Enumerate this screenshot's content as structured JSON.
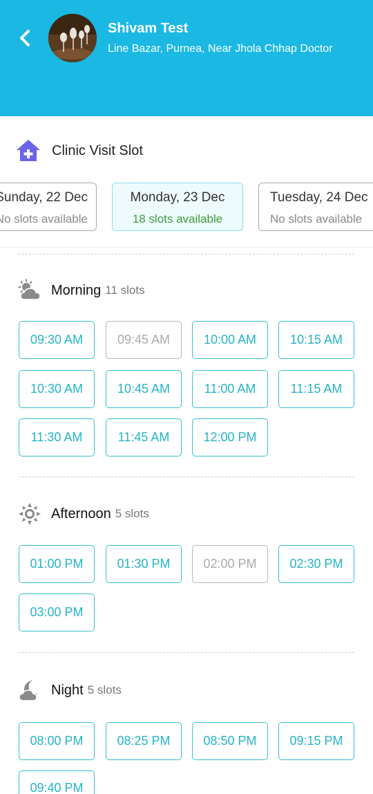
{
  "header": {
    "doctor_name": "Shivam Test",
    "address": "Line Bazar, Purnea, Near Jhola Chhap Doctor",
    "back_icon": "chevron-left-icon",
    "bg_color": "#1ab8e3"
  },
  "section": {
    "title": "Clinic Visit Slot",
    "icon": "clinic-plus-icon",
    "icon_color": "#6b63e8"
  },
  "dates": [
    {
      "day": "Sunday, 22 Dec",
      "availability": "No slots available",
      "selected": false
    },
    {
      "day": "Monday, 23 Dec",
      "availability": "18 slots available",
      "selected": true
    },
    {
      "day": "Tuesday, 24 Dec",
      "availability": "No slots available",
      "selected": false
    }
  ],
  "periods": [
    {
      "name": "Morning",
      "count": "11 slots",
      "icon": "sun-cloud-icon",
      "slots": [
        {
          "time": "09:30 AM",
          "enabled": true
        },
        {
          "time": "09:45 AM",
          "enabled": false
        },
        {
          "time": "10:00 AM",
          "enabled": true
        },
        {
          "time": "10:15 AM",
          "enabled": true
        },
        {
          "time": "10:30 AM",
          "enabled": true
        },
        {
          "time": "10:45 AM",
          "enabled": true
        },
        {
          "time": "11:00 AM",
          "enabled": true
        },
        {
          "time": "11:15 AM",
          "enabled": true
        },
        {
          "time": "11:30 AM",
          "enabled": true
        },
        {
          "time": "11:45 AM",
          "enabled": true
        },
        {
          "time": "12:00 PM",
          "enabled": true
        }
      ]
    },
    {
      "name": "Afternoon",
      "count": "5 slots",
      "icon": "sun-icon",
      "slots": [
        {
          "time": "01:00 PM",
          "enabled": true
        },
        {
          "time": "01:30 PM",
          "enabled": true
        },
        {
          "time": "02:00 PM",
          "enabled": false
        },
        {
          "time": "02:30 PM",
          "enabled": true
        },
        {
          "time": "03:00 PM",
          "enabled": true
        }
      ]
    },
    {
      "name": "Night",
      "count": "5 slots",
      "icon": "moon-cloud-icon",
      "slots": [
        {
          "time": "08:00 PM",
          "enabled": true
        },
        {
          "time": "08:25 PM",
          "enabled": true
        },
        {
          "time": "08:50 PM",
          "enabled": true
        },
        {
          "time": "09:15 PM",
          "enabled": true
        },
        {
          "time": "09:40 PM",
          "enabled": true
        }
      ]
    }
  ]
}
